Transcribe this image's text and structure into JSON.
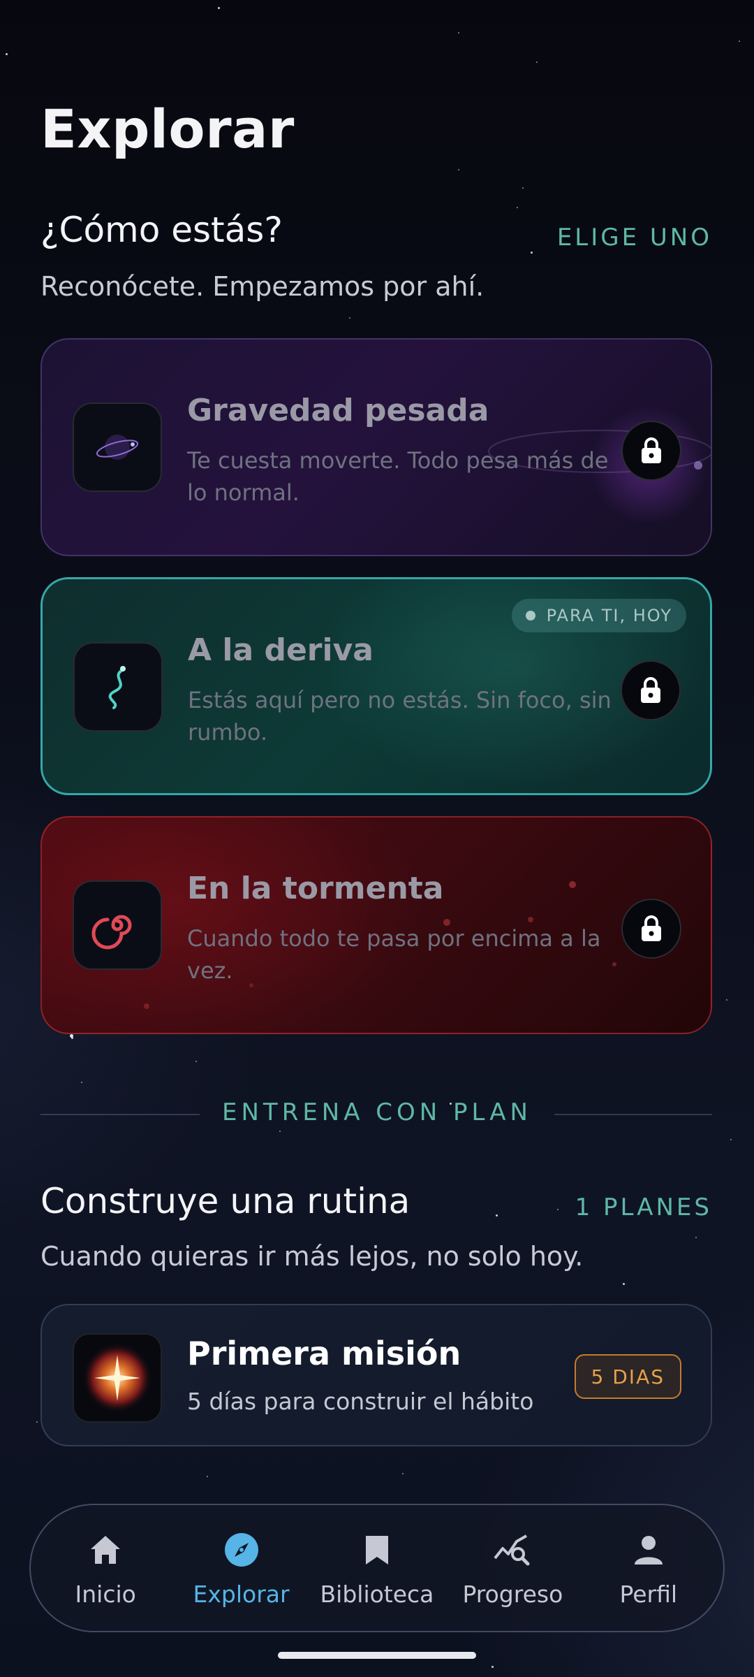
{
  "page": {
    "title": "Explorar"
  },
  "mood_section": {
    "heading": "¿Cómo estás?",
    "action": "ELIGE UNO",
    "subtitle": "Reconócete. Empezamos por ahí.",
    "cards": [
      {
        "title": "Gravedad pesada",
        "description": "Te cuesta moverte. Todo pesa más de lo normal.",
        "icon": "planet-icon",
        "locked": true,
        "accent": "#7b4fc0"
      },
      {
        "title": "A la deriva",
        "description": "Estás aquí pero no estás. Sin foco, sin rumbo.",
        "icon": "drift-icon",
        "locked": true,
        "badge": "PARA TI, HOY",
        "accent": "#35a8a8"
      },
      {
        "title": "En la tormenta",
        "description": "Cuando todo te pasa por encima a la vez.",
        "icon": "storm-spiral-icon",
        "locked": true,
        "accent": "#c8323c"
      }
    ]
  },
  "divider": {
    "label": "ENTRENA CON PLAN"
  },
  "plans_section": {
    "heading": "Construye una rutina",
    "action": "1 PLANES",
    "subtitle": "Cuando quieras ir más lejos, no solo hoy.",
    "plans": [
      {
        "title": "Primera misión",
        "description": "5 días para construir el hábito",
        "badge": "5 DIAS",
        "icon": "star-burst-icon"
      }
    ]
  },
  "nav": {
    "active": "Explorar",
    "items": [
      {
        "label": "Inicio",
        "icon": "home-icon"
      },
      {
        "label": "Explorar",
        "icon": "compass-icon"
      },
      {
        "label": "Biblioteca",
        "icon": "bookmark-icon"
      },
      {
        "label": "Progreso",
        "icon": "chart-search-icon"
      },
      {
        "label": "Perfil",
        "icon": "person-icon"
      }
    ]
  },
  "colors": {
    "accent_teal": "#5fb8a6",
    "nav_active": "#56b4e6",
    "badge_orange": "#e6a14a"
  }
}
